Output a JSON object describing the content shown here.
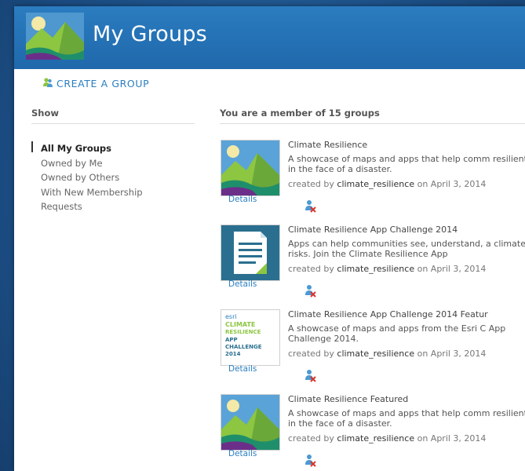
{
  "header": {
    "title": "My Groups",
    "logo_icon": "landscape-logo-icon",
    "background_color": "#2371b5"
  },
  "create_group": {
    "label": "CREATE A GROUP",
    "icon": "add-group-icon"
  },
  "sidebar": {
    "heading": "Show",
    "filters": [
      {
        "label": "All My Groups",
        "active": true
      },
      {
        "label": "Owned by Me",
        "active": false
      },
      {
        "label": "Owned by Others",
        "active": false
      },
      {
        "label": "With New Membership Requests",
        "active": false
      }
    ]
  },
  "main": {
    "heading": "You are a member of 15 groups",
    "groups": [
      {
        "title": "Climate Resilience",
        "description": "A showcase of maps and apps that help comm resilient in the face of a disaster.",
        "created_prefix": "created by",
        "owner": "climate_resilience",
        "created_suffix": "on April 3, 2014",
        "details_label": "Details",
        "thumb_icon": "landscape-thumbnail-icon",
        "action_icon": "leave-group-icon"
      },
      {
        "title": "Climate Resilience App Challenge 2014",
        "description": "Apps can help communities see, understand, a climate risks. Join the Climate Resilience App",
        "created_prefix": "created by",
        "owner": "climate_resilience",
        "created_suffix": "on April 3, 2014",
        "details_label": "Details",
        "thumb_icon": "document-thumbnail-icon",
        "action_icon": "leave-group-icon"
      },
      {
        "title": "Climate Resilience App Challenge 2014 Featur",
        "description": "A showcase of maps and apps from the Esri C App Challenge 2014.",
        "created_prefix": "created by",
        "owner": "climate_resilience",
        "created_suffix": "on April 3, 2014",
        "details_label": "Details",
        "thumb_icon": "challenge-logo-thumbnail-icon",
        "thumb_text": [
          "esri",
          "CLIMATE",
          "RESILIENCE",
          "APP",
          "CHALLENGE",
          "2014"
        ],
        "action_icon": "leave-group-icon"
      },
      {
        "title": "Climate Resilience Featured",
        "description": "A showcase of maps and apps that help comm resilient in the face of a disaster.",
        "created_prefix": "created by",
        "owner": "climate_resilience",
        "created_suffix": "on April 3, 2014",
        "details_label": "Details",
        "thumb_icon": "landscape-thumbnail-icon",
        "action_icon": "leave-group-icon"
      }
    ]
  }
}
